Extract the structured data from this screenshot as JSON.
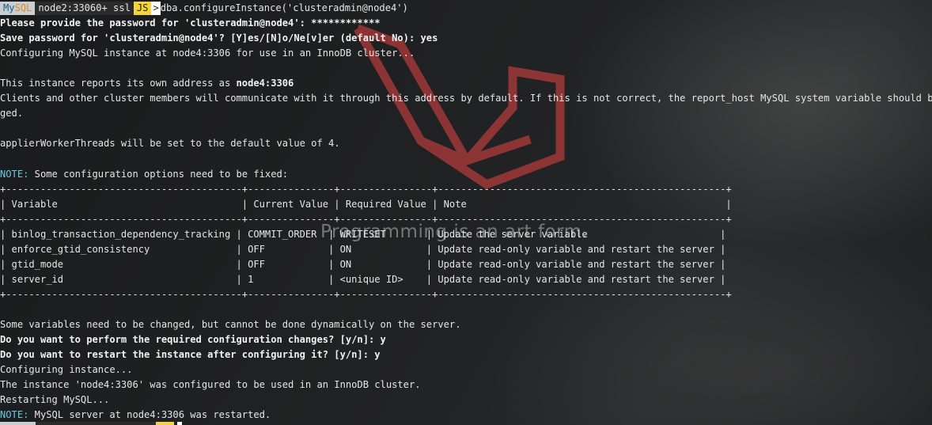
{
  "prompt": {
    "my": "My",
    "sql": "SQL",
    "host": "node2:33060+ ssl",
    "mode": "JS",
    "arrow": ">",
    "command": "dba.configureInstance('clusteradmin@node4')"
  },
  "output": {
    "password_prompt": "Please provide the password for 'clusteradmin@node4': ************",
    "save_password": "Save password for 'clusteradmin@node4'? [Y]es/[N]o/Ne[v]er (default No): yes",
    "configuring": "Configuring MySQL instance at node4:3306 for use in an InnoDB cluster...",
    "address_prefix": "This instance reports its own address as ",
    "address_value": "node4:3306",
    "clients_line1": "Clients and other cluster members will communicate with it through this address by default. If this is not correct, the report_host MySQL system variable should be chan",
    "clients_line2": "ged.",
    "applier": "applierWorkerThreads will be set to the default value of 4.",
    "note_label": "NOTE:",
    "note_fix": " Some configuration options need to be fixed:",
    "table": {
      "border": "+-----------------------------------------+---------------+----------------+--------------------------------------------------+",
      "header": "| Variable                                | Current Value | Required Value | Note                                             |",
      "rows": [
        "| binlog_transaction_dependency_tracking | COMMIT_ORDER  | WRITESET       | Update the server variable                       |",
        "| enforce_gtid_consistency               | OFF           | ON             | Update read-only variable and restart the server |",
        "| gtid_mode                              | OFF           | ON             | Update read-only variable and restart the server |",
        "| server_id                              | 1             | <unique ID>    | Update read-only variable and restart the server |"
      ]
    },
    "some_vars": "Some variables need to be changed, but cannot be done dynamically on the server.",
    "perform_changes": "Do you want to perform the required configuration changes? [y/n]: y",
    "restart_instance": "Do you want to restart the instance after configuring it? [y/n]: y",
    "configuring_instance": "Configuring instance...",
    "configured": "The instance 'node4:3306' was configured to be used in an InnoDB cluster.",
    "restarting": "Restarting MySQL...",
    "note_restarted": " MySQL server at node4:3306 was restarted."
  },
  "wallpaper": {
    "tagline": "Programming is an art form.",
    "logo_icon": "laravel-logo-icon",
    "logo_color": "#b0393a"
  }
}
